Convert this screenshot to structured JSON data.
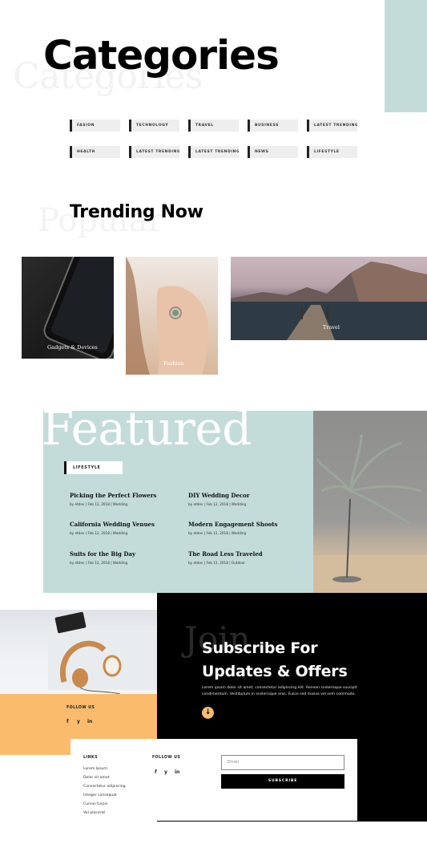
{
  "categories": {
    "title": "Categories",
    "ghost": "Categories",
    "tags_row1": [
      "FASION",
      "TECHNOLOGY",
      "TRAVEL",
      "BUSINESS",
      "LATEST TRENDING"
    ],
    "tags_row2": [
      "HEALTH",
      "LATEST TRENDING",
      "LATEST TRENDING",
      "NEWS",
      "LIFESTYLE"
    ]
  },
  "trending": {
    "title": "Trending Now",
    "ghost": "Popular",
    "cards": [
      {
        "label": "Gadgets & Devices"
      },
      {
        "label": "Fashion"
      },
      {
        "label": "Travel"
      }
    ]
  },
  "featured": {
    "title": "Featured",
    "tag": "LIFESTYLE",
    "posts": [
      {
        "title": "Picking the Perfect Flowers",
        "meta": "by etdev | Feb 12, 2018 | Wedding"
      },
      {
        "title": "DIY Wedding Decor",
        "meta": "by etdev | Feb 12, 2018 | Wedding"
      },
      {
        "title": "California Wedding Venues",
        "meta": "by etdev | Feb 12, 2018 | Wedding"
      },
      {
        "title": "Modern Engagement Shoots",
        "meta": "by etdev | Feb 12, 2018 | Wedding"
      },
      {
        "title": "Suits for the Big Day",
        "meta": "by etdev | Feb 12, 2018 | Wedding"
      },
      {
        "title": "The Road Less Traveled",
        "meta": "by etdev | Feb 12, 2018 | Outdoor"
      }
    ]
  },
  "subscribe": {
    "ghost": "Join",
    "title_line1": "Subscribe For",
    "title_line2": "Updates & Offers",
    "text": "Lorem ipsum dolor sit amet, consectetur adipiscing elit. Aenean scelerisque suscipit condimentum. Vestibulum in scelerisque eros. Fusce sed massa vel sem commodo.",
    "arrow_icon": "arrow-down-icon",
    "follow_label": "FOLLOW US",
    "social": [
      "f",
      "y",
      "in"
    ]
  },
  "footer": {
    "links_heading": "LINKS",
    "links": [
      "Lorem Ipsum",
      "Dolor sit amet",
      "Consectetur adipiscing",
      "Integer consequat",
      "Cursus turpis",
      "Vel placerat"
    ],
    "follow_heading": "FOLLOW US",
    "social": [
      "f",
      "y",
      "in"
    ],
    "email_placeholder": "Email",
    "subscribe_label": "SUBSCRIBE"
  },
  "colors": {
    "teal": "#c3dcd9",
    "orange": "#fbbb6c",
    "black": "#000000"
  }
}
